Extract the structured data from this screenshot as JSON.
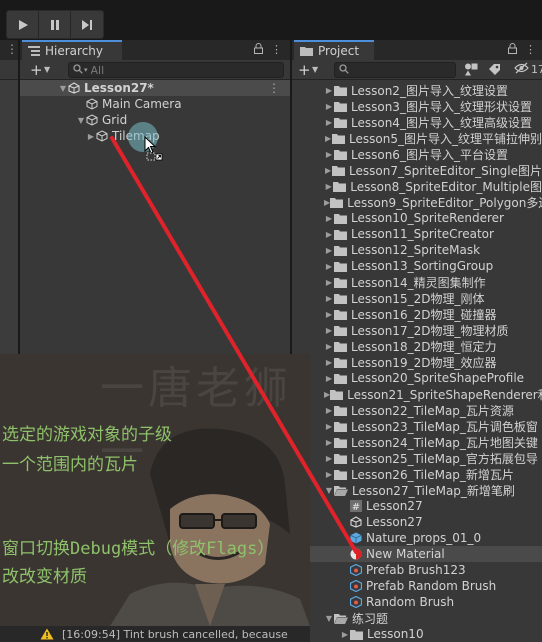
{
  "toolbar": {
    "play_icon": "play-icon",
    "pause_icon": "pause-icon",
    "step_icon": "step-icon"
  },
  "hierarchy": {
    "tab_label": "Hierarchy",
    "search_placeholder": "All",
    "scene_name": "Lesson27*",
    "items": [
      {
        "label": "Main Camera",
        "depth": 1,
        "icon": "gameobject-icon",
        "expanded": null
      },
      {
        "label": "Grid",
        "depth": 1,
        "icon": "gameobject-icon",
        "expanded": true
      },
      {
        "label": "Tilemap",
        "depth": 2,
        "icon": "gameobject-icon",
        "expanded": false
      }
    ]
  },
  "project": {
    "tab_label": "Project",
    "hidden_count_label": "17",
    "folders": [
      "Lesson2_图片导入_纹理设置",
      "Lesson3_图片导入_纹理形状设置",
      "Lesson4_图片导入_纹理高级设置",
      "Lesson5_图片导入_纹理平铺拉伸别",
      "Lesson6_图片导入_平台设置",
      "Lesson7_SpriteEditor_Single图片",
      "Lesson8_SpriteEditor_Multiple图",
      "Lesson9_SpriteEditor_Polygon多边",
      "Lesson10_SpriteRenderer",
      "Lesson11_SpriteCreator",
      "Lesson12_SpriteMask",
      "Lesson13_SortingGroup",
      "Lesson14_精灵图集制作",
      "Lesson15_2D物理_刚体",
      "Lesson16_2D物理_碰撞器",
      "Lesson17_2D物理_物理材质",
      "Lesson18_2D物理_恒定力",
      "Lesson19_2D物理_效应器",
      "Lesson20_SpriteShapeProfile",
      "Lesson21_SpriteShapeRenderer和",
      "Lesson22_TileMap_瓦片资源",
      "Lesson23_TileMap_瓦片调色板窗",
      "Lesson24_TileMap_瓦片地图关键",
      "Lesson25_TileMap_官方拓展包导",
      "Lesson26_TileMap_新增瓦片"
    ],
    "open_folder": "Lesson27_TileMap_新增笔刷",
    "open_folder_children": [
      {
        "label": "Lesson27",
        "icon": "script-icon",
        "selected": false
      },
      {
        "label": "Lesson27",
        "icon": "scene-icon",
        "selected": false
      },
      {
        "label": "Nature_props_01_0",
        "icon": "prefab-icon",
        "selected": false
      },
      {
        "label": "New Material",
        "icon": "material-icon",
        "selected": true
      },
      {
        "label": "Prefab Brush123",
        "icon": "brush-asset-icon",
        "selected": false
      },
      {
        "label": "Prefab Random Brush",
        "icon": "brush-asset-icon",
        "selected": false
      },
      {
        "label": "Random Brush",
        "icon": "brush-asset-icon",
        "selected": false
      }
    ],
    "exercise_folder": "练习题",
    "exercise_children": [
      "Lesson10"
    ]
  },
  "overlay": {
    "watermark": "一唐老狮一",
    "notes": [
      "选定的游戏对象的子级",
      "一个范围内的瓦片",
      "窗口切换Debug模式（修改Flags）",
      "改改变材质"
    ]
  },
  "console": {
    "message": "[16:09:54] Tint brush cancelled, because"
  },
  "colors": {
    "accent": "#4d90d9",
    "drag_line": "#e0232b",
    "note_text": "#8ec26a"
  }
}
